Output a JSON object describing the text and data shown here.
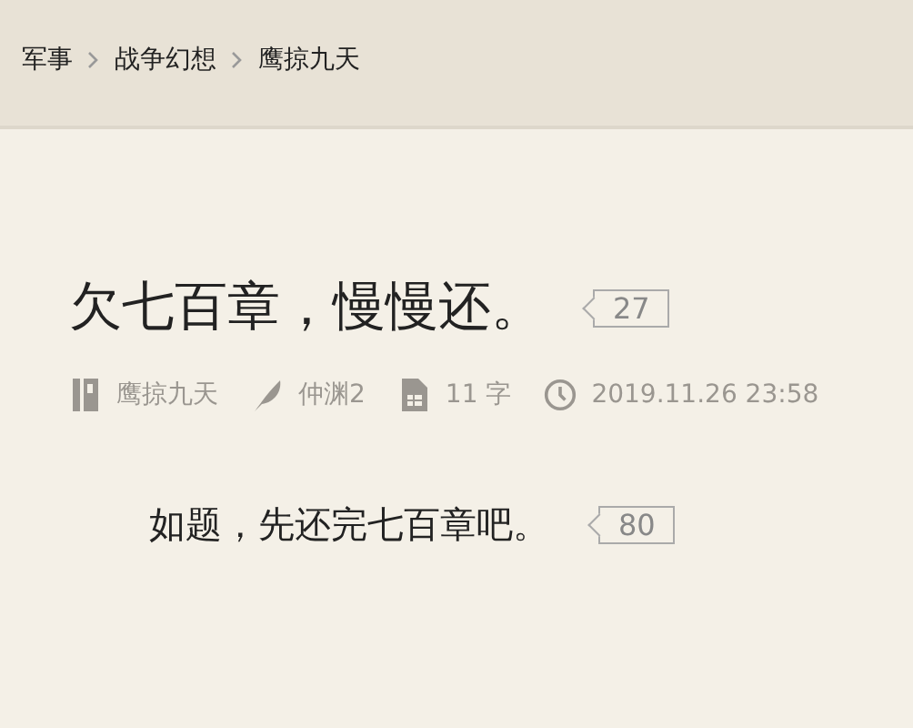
{
  "breadcrumb": [
    {
      "label": "军事"
    },
    {
      "label": "战争幻想"
    },
    {
      "label": "鹰掠九天"
    }
  ],
  "post": {
    "title": "欠七百章，慢慢还。",
    "reply_count": "27",
    "book": "鹰掠九天",
    "author": "仲渊2",
    "word_count": "11 字",
    "date": "2019.11.26 23:58"
  },
  "reply": {
    "text": "如题，先还完七百章吧。",
    "count": "80"
  }
}
